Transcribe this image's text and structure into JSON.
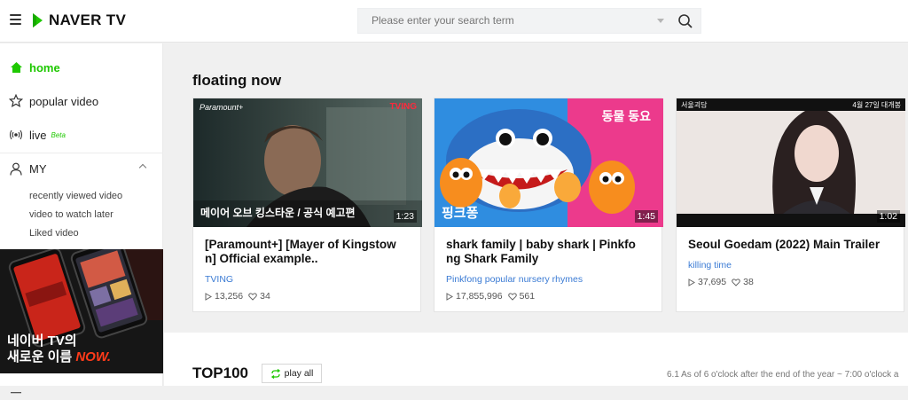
{
  "header": {
    "logo_text": "NAVER TV",
    "search_placeholder": "Please enter your search term"
  },
  "sidebar": {
    "nav": [
      {
        "label": "home",
        "icon": "home-icon",
        "active": true
      },
      {
        "label": "popular video",
        "icon": "star-icon",
        "active": false
      },
      {
        "label": "live",
        "icon": "live-icon",
        "badge": "Beta",
        "active": false
      },
      {
        "label": "MY",
        "icon": "user-icon",
        "active": false
      }
    ],
    "my_items": [
      "recently viewed video",
      "video to watch later",
      "Liked video"
    ],
    "ad": {
      "line1": "네이버 TV의",
      "line2_prefix": "새로운 이름",
      "line2_highlight": "NOW."
    }
  },
  "main": {
    "section_title": "floating now",
    "cards": [
      {
        "title": "[Paramount+] [Mayer of Kingstow n] Official example..",
        "channel": "TVING",
        "views": "13,256",
        "likes": "34",
        "duration": "1:23",
        "thumb_tag_left": "Paramount+",
        "thumb_tag_right": "TVING",
        "thumb_caption": "메이어 오브 킹스타운 / 공식 예고편"
      },
      {
        "title": "shark family | baby shark | Pinkfo ng Shark Family",
        "channel": "Pinkfong popular nursery rhymes",
        "views": "17,855,996",
        "likes": "561",
        "duration": "1:45",
        "thumb_tag_right": "동물 동요",
        "thumb_caption": "핑크퐁"
      },
      {
        "title": "Seoul Goedam (2022) Main Trailer",
        "channel": "killing time",
        "views": "37,695",
        "likes": "38",
        "duration": "1:02",
        "thumb_tag_left": "서울괴담",
        "thumb_tag_right": "4월 27일 대개봉"
      }
    ],
    "top100": {
      "title": "TOP100",
      "play_all": "play all",
      "note": "6.1 As of 6 o'clock after the end of the year ~ 7:00 o'clock a"
    }
  },
  "colors": {
    "accent": "#1ec800",
    "link": "#3b7bd4"
  }
}
